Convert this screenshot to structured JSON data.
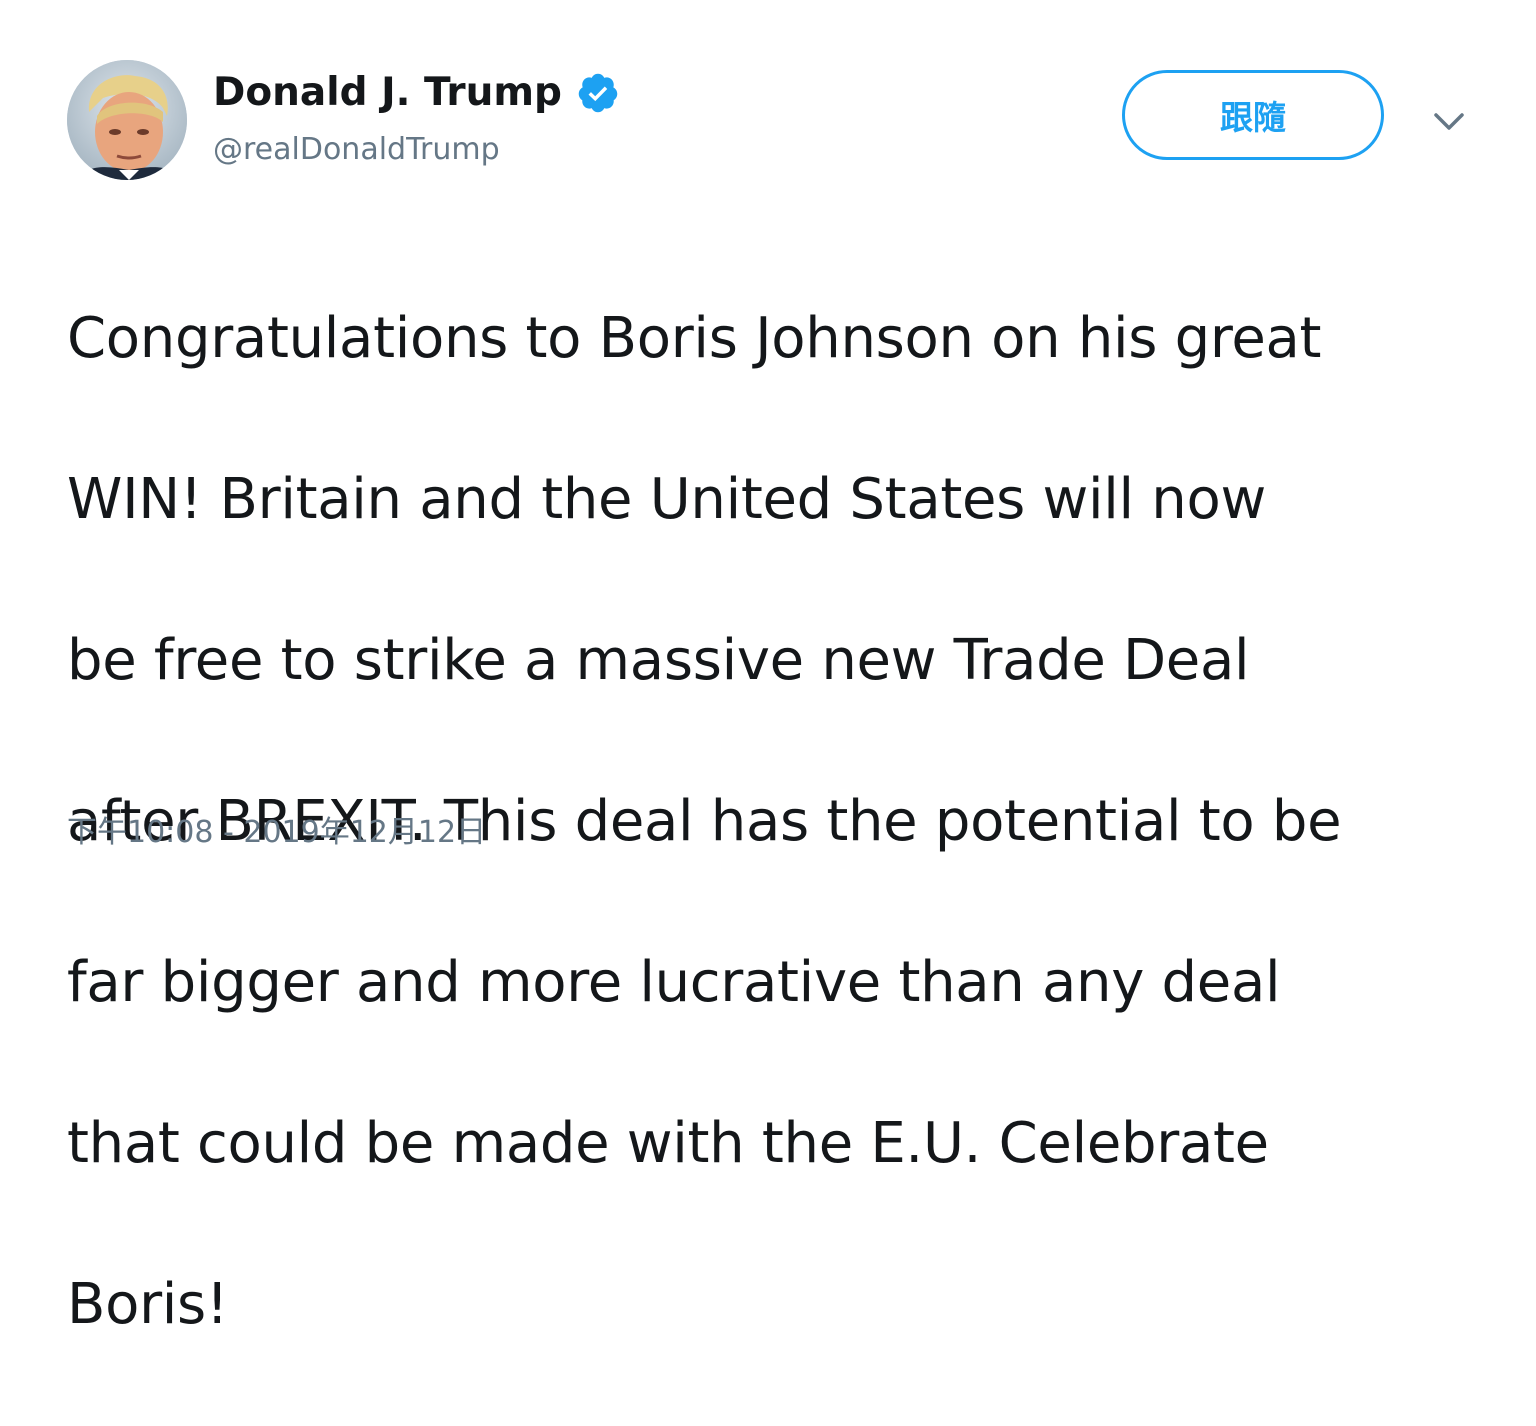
{
  "author": {
    "display_name": "Donald J. Trump",
    "handle": "@realDonaldTrump",
    "verified": true
  },
  "actions": {
    "follow_label": "跟隨",
    "more_icon": "chevron-down-icon"
  },
  "tweet": {
    "text_lines": [
      "Congratulations to Boris Johnson on his great",
      "WIN! Britain and the United States will now",
      "be free to strike a massive new Trade Deal",
      "after BREXIT. This deal has the potential to be",
      "far bigger and more lucrative than any deal",
      "that could be made with the E.U. Celebrate",
      "Boris!"
    ],
    "timestamp": "下午10:08 - 2019年12月12日"
  },
  "colors": {
    "accent": "#1da1f2",
    "text": "#14171a",
    "secondary_text": "#657786"
  }
}
